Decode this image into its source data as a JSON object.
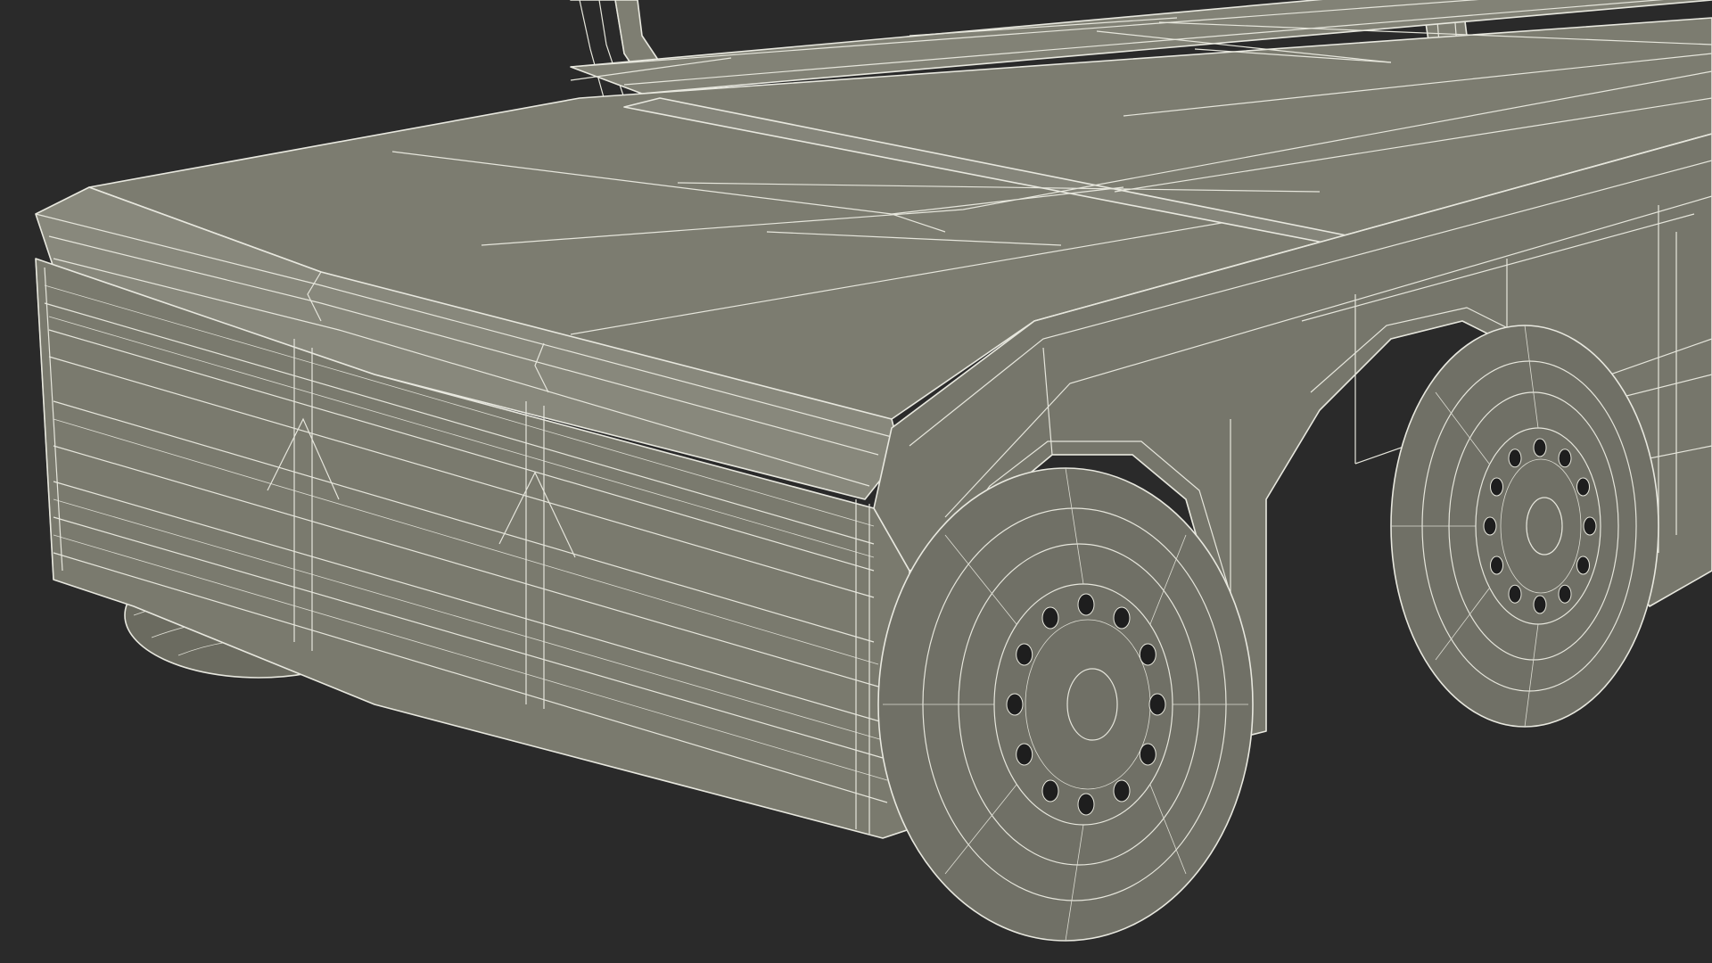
{
  "scene": {
    "subject_icon": "wireframe-flatbed-cart-icon",
    "colors": {
      "background": "#2a2a2a",
      "mesh_fill": "#7a7a6e",
      "mesh_fill_dark": "#6b6b60",
      "mesh_fill_light": "#85857a",
      "wire": "#e6e6dc",
      "tire": "#707066",
      "hole": "#1e1e1e"
    },
    "lug_hole_count": 12
  }
}
